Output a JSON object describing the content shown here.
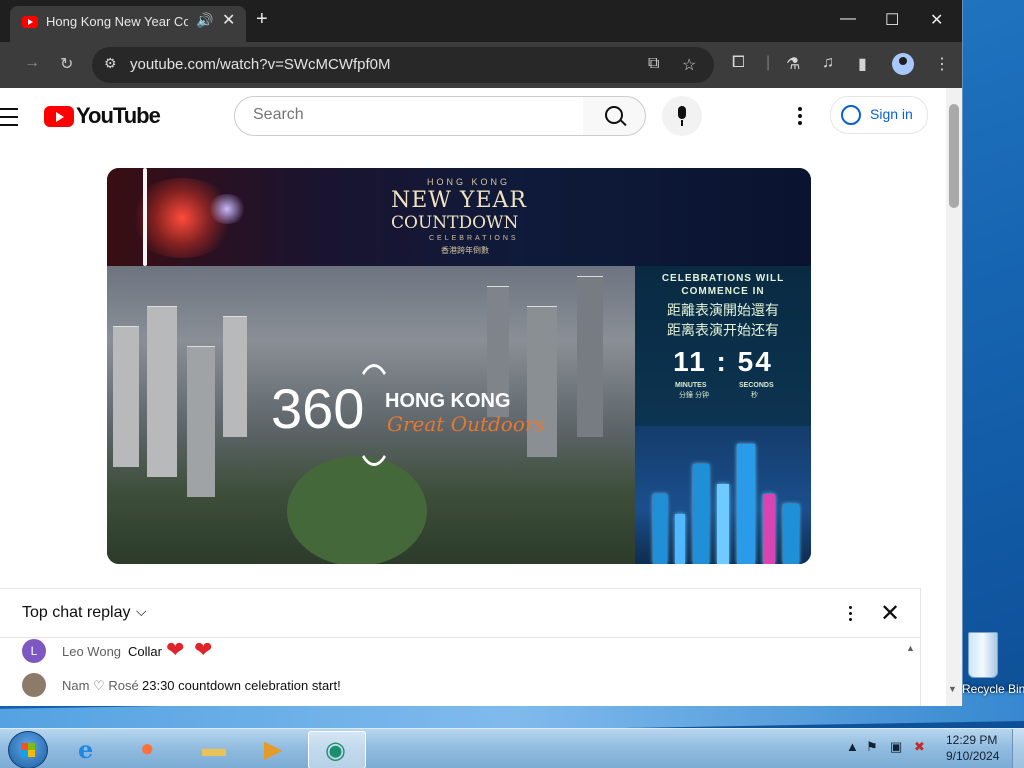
{
  "browser": {
    "tab_title": "Hong Kong New Year Countdown",
    "url": "youtube.com/watch?v=SWcMCWfpf0M",
    "new_tab_glyph": "+",
    "minimize_glyph": "—",
    "maximize_glyph": "☐",
    "close_glyph": "✕"
  },
  "youtube": {
    "logo_text": "YouTube",
    "search_placeholder": "Search",
    "sign_in_label": "Sign in"
  },
  "video": {
    "brand_line1": "HONG KONG",
    "brand_line2": "NEW YEAR",
    "brand_line3": "COUNTDOWN",
    "brand_line4": "CELEBRATIONS",
    "brand_line5": "香港跨年倒數",
    "commence_en_1": "CELEBRATIONS WILL",
    "commence_en_2": "COMMENCE IN",
    "commence_zh_trad": "距離表演開始還有",
    "commence_zh_simp": "距离表演开始还有",
    "timer": "11 : 54",
    "minutes_label": "MINUTES",
    "seconds_label": "SECONDS",
    "minutes_zh": "分鐘 分钟",
    "seconds_zh": "秒",
    "logo_360": "360",
    "logo_hk": "HONG KONG",
    "logo_script": "Great Outdoors"
  },
  "chat": {
    "title": "Top chat replay",
    "messages": [
      {
        "initial": "L",
        "author": "Leo Wong",
        "text": "Collar",
        "avatar_color": "#7e57c2",
        "hearts": "❤️❤️"
      },
      {
        "initial": "",
        "author": "Nam ♡ Rosé",
        "text": "23:30 countdown celebration start!",
        "avatar_color": "#8d7b6a"
      }
    ]
  },
  "desktop": {
    "recycle_bin_label": "Recycle Bin"
  },
  "taskbar": {
    "time": "12:29 PM",
    "date": "9/10/2024"
  },
  "colors": {
    "youtube_red": "#ff0000",
    "signin_blue": "#065fd4",
    "chrome_dark": "#1f1f1f"
  }
}
